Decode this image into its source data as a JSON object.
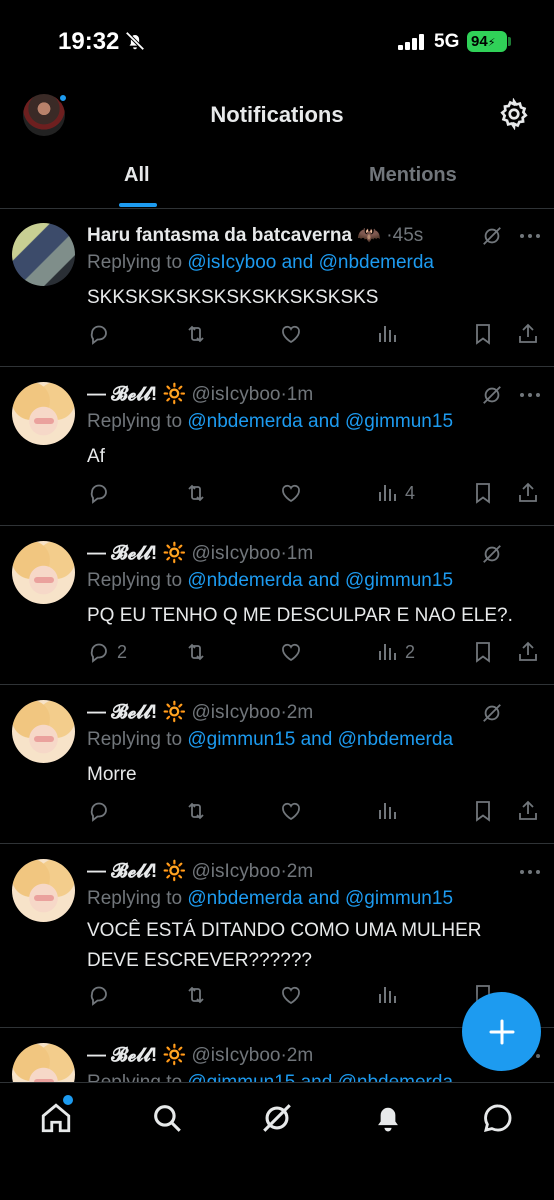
{
  "status": {
    "time": "19:32",
    "network": "5G",
    "battery": "94"
  },
  "header": {
    "title": "Notifications",
    "tabs": [
      {
        "label": "All",
        "active": true
      },
      {
        "label": "Mentions",
        "active": false
      }
    ]
  },
  "tweets": [
    {
      "name": "Haru fantasma da batcaverna",
      "handle": "",
      "time": "·45s",
      "replying_prefix": "Replying to ",
      "mentions": "@isIcyboo and @nbdemerda",
      "text": "SKKSKSKSKSKSKSKKSKSKSKS",
      "replies": "",
      "views": ""
    },
    {
      "name": "— 𝓑𝓮𝓵𝓵! 🔆",
      "handle": "@isIcyboo",
      "time": "·1m",
      "replying_prefix": "Replying to ",
      "mentions": "@nbdemerda and @gimmun15",
      "text": "Af",
      "replies": "",
      "views": "4"
    },
    {
      "name": "— 𝓑𝓮𝓵𝓵! 🔆",
      "handle": "@isIcyboo",
      "time": "·1m",
      "replying_prefix": "Replying to ",
      "mentions": "@nbdemerda and @gimmun15",
      "text": "PQ EU TENHO Q ME DESCULPAR E NAO ELE?.",
      "replies": "2",
      "views": "2"
    },
    {
      "name": "— 𝓑𝓮𝓵𝓵! 🔆",
      "handle": "@isIcyboo",
      "time": "·2m",
      "replying_prefix": "Replying to ",
      "mentions": "@gimmun15 and @nbdemerda",
      "text": "Morre",
      "replies": "",
      "views": ""
    },
    {
      "name": "— 𝓑𝓮𝓵𝓵! 🔆",
      "handle": "@isIcyboo",
      "time": "·2m",
      "replying_prefix": "Replying to ",
      "mentions": "@nbdemerda and @gimmun15",
      "text": "VOCÊ ESTÁ DITANDO COMO UMA MULHER DEVE ESCREVER??????",
      "replies": "",
      "views": ""
    },
    {
      "name": "— 𝓑𝓮𝓵𝓵! 🔆",
      "handle": "@isIcyboo",
      "time": "·2m",
      "replying_prefix": "Replying to ",
      "mentions": "@gimmun15 and @nbdemerda",
      "text": "",
      "replies": "",
      "views": ""
    }
  ],
  "colors": {
    "accent": "#1d9bf0",
    "muted": "#71767b",
    "text": "#e7e9ea",
    "background": "#000000"
  },
  "icons": [
    "bell-slash-icon",
    "signal-icon",
    "gear-icon",
    "reply-icon",
    "retweet-icon",
    "like-icon",
    "views-icon",
    "bookmark-icon",
    "share-icon",
    "grok-icon",
    "more-icon",
    "plus-icon",
    "home-icon",
    "search-icon",
    "bell-icon",
    "messages-icon"
  ]
}
